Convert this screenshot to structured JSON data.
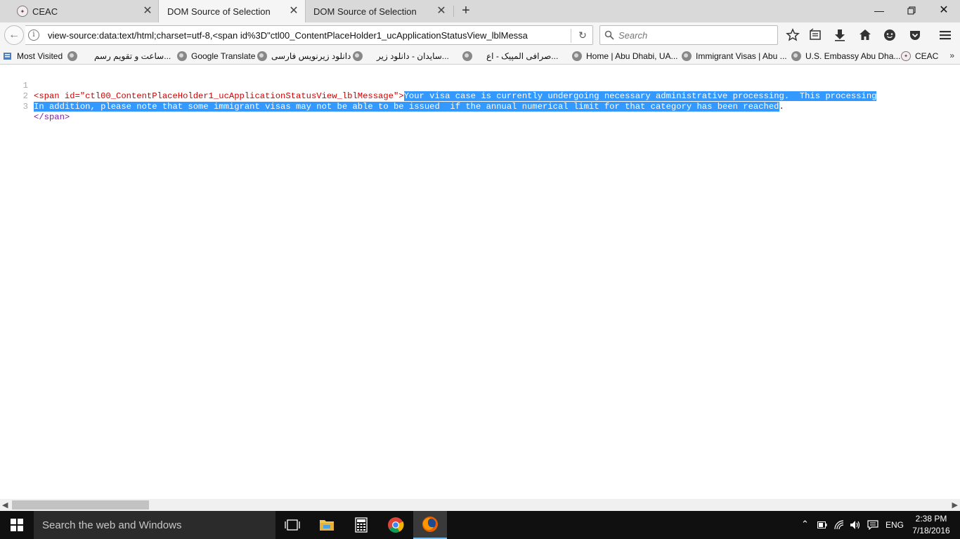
{
  "tabs": [
    {
      "label": "CEAC",
      "active": false
    },
    {
      "label": "DOM Source of Selection",
      "active": true
    },
    {
      "label": "DOM Source of Selection",
      "active": false
    }
  ],
  "url": "view-source:data:text/html;charset=utf-8,<span id%3D\"ctl00_ContentPlaceHolder1_ucApplicationStatusView_lblMessa",
  "search": {
    "placeholder": "Search"
  },
  "bookmarks": [
    {
      "label": "Most Visited"
    },
    {
      "label": "ساعت و تقویم رسم..."
    },
    {
      "label": "Google Translate"
    },
    {
      "label": "دانلود زیرنویس فارسی"
    },
    {
      "label": "سایدان - دانلود زیر..."
    },
    {
      "label": "صرافی المپیک - اع..."
    },
    {
      "label": "Home | Abu Dhabi, UA..."
    },
    {
      "label": "Immigrant Visas | Abu ..."
    },
    {
      "label": "U.S. Embassy Abu Dha..."
    },
    {
      "label": "CEAC"
    }
  ],
  "source": {
    "line_numbers": [
      "1",
      "2",
      "3"
    ],
    "line1_open_tag": "<span id=",
    "line1_id_value": "\"ctl00_ContentPlaceHolder1_ucApplicationStatusView_lblMessage\"",
    "line1_tag_end": ">",
    "line1_text": "Your visa case is currently undergoing necessary administrative processing.  This processing",
    "line2_text": "In addition, please note that some immigrant visas may not be able to be issued  if the annual numerical limit for that category has been reached",
    "line2_end": ".",
    "line3_close_tag": "</span>"
  },
  "taskbar": {
    "search_placeholder": "Search the web and Windows",
    "language": "ENG",
    "time": "2:38 PM",
    "date": "7/18/2016"
  }
}
